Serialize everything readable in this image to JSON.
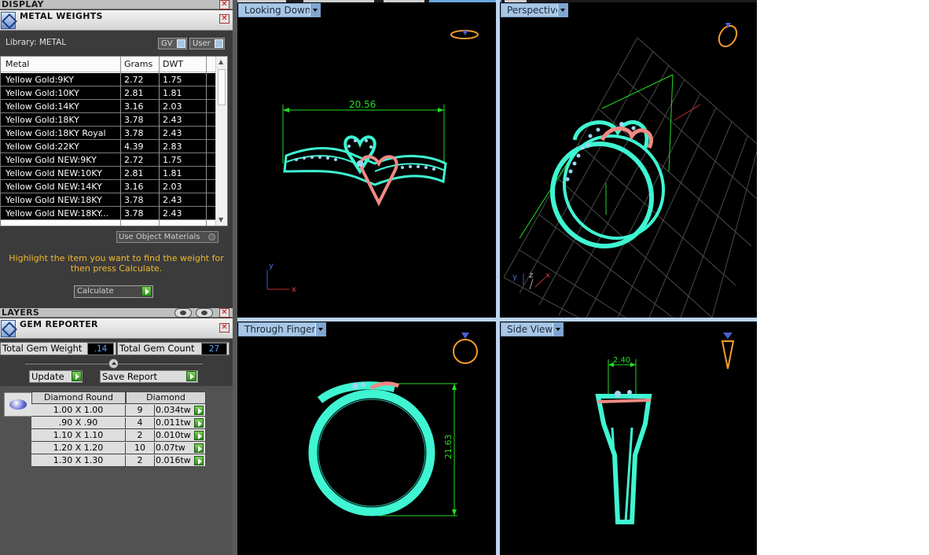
{
  "display_bar": {
    "label": "DISPLAY"
  },
  "metal_weights": {
    "title": "METAL WEIGHTS",
    "library_label": "Library: METAL",
    "gv_label": "GV",
    "user_label": "User",
    "columns": [
      "Metal",
      "Grams",
      "DWT"
    ],
    "rows": [
      {
        "metal": "Yellow Gold:9KY",
        "grams": "2.72",
        "dwt": "1.75"
      },
      {
        "metal": "Yellow Gold:10KY",
        "grams": "2.81",
        "dwt": "1.81"
      },
      {
        "metal": "Yellow Gold:14KY",
        "grams": "3.16",
        "dwt": "2.03"
      },
      {
        "metal": "Yellow Gold:18KY",
        "grams": "3.78",
        "dwt": "2.43"
      },
      {
        "metal": "Yellow Gold:18KY Royal",
        "grams": "3.78",
        "dwt": "2.43"
      },
      {
        "metal": "Yellow Gold:22KY",
        "grams": "4.39",
        "dwt": "2.83"
      },
      {
        "metal": "Yellow Gold NEW:9KY",
        "grams": "2.72",
        "dwt": "1.75"
      },
      {
        "metal": "Yellow Gold NEW:10KY",
        "grams": "2.81",
        "dwt": "1.81"
      },
      {
        "metal": "Yellow Gold NEW:14KY",
        "grams": "3.16",
        "dwt": "2.03"
      },
      {
        "metal": "Yellow Gold NEW:18KY",
        "grams": "3.78",
        "dwt": "2.43"
      },
      {
        "metal": "Yellow Gold NEW:18KY...",
        "grams": "3.78",
        "dwt": "2.43"
      }
    ],
    "use_object_materials": "Use Object Materials",
    "hint": "Highlight the item you want to find the weight for then press Calculate.",
    "calculate_label": "Calculate"
  },
  "layers_bar": {
    "label": "LAYERS"
  },
  "gem_reporter": {
    "title": "GEM REPORTER",
    "total_weight_label": "Total Gem Weight",
    "total_weight_value": ".14",
    "total_count_label": "Total Gem Count",
    "total_count_value": "27",
    "update_label": "Update",
    "save_report_label": "Save Report",
    "table_headers": [
      "Diamond Round",
      "Diamond"
    ],
    "rows": [
      {
        "size": "1.00 X 1.00",
        "count": "9",
        "tw": "0.034tw"
      },
      {
        "size": ".90 X .90",
        "count": "4",
        "tw": "0.011tw"
      },
      {
        "size": "1.10 X 1.10",
        "count": "2",
        "tw": "0.010tw"
      },
      {
        "size": "1.20 X 1.20",
        "count": "10",
        "tw": "0.07tw"
      },
      {
        "size": "1.30 X 1.30",
        "count": "2",
        "tw": "0.016tw"
      }
    ]
  },
  "viewports": {
    "top_left": {
      "label": "Looking Down",
      "dimension": "20.56",
      "axis_y": "y",
      "axis_x": "x"
    },
    "top_right": {
      "label": "Perspective",
      "axis_y": "y",
      "axis_z": "z",
      "axis_x": "x"
    },
    "bottom_left": {
      "label": "Through Finger",
      "dimension": "21.63"
    },
    "bottom_right": {
      "label": "Side View",
      "dimension": "2.40"
    }
  },
  "colors": {
    "ring": "#3ff5d2",
    "heart": "#f08a84",
    "stones": "#9fd5f0",
    "dimension": "#22dd22",
    "hint_text": "#f0b92e",
    "tab": "#a8c6e5"
  }
}
